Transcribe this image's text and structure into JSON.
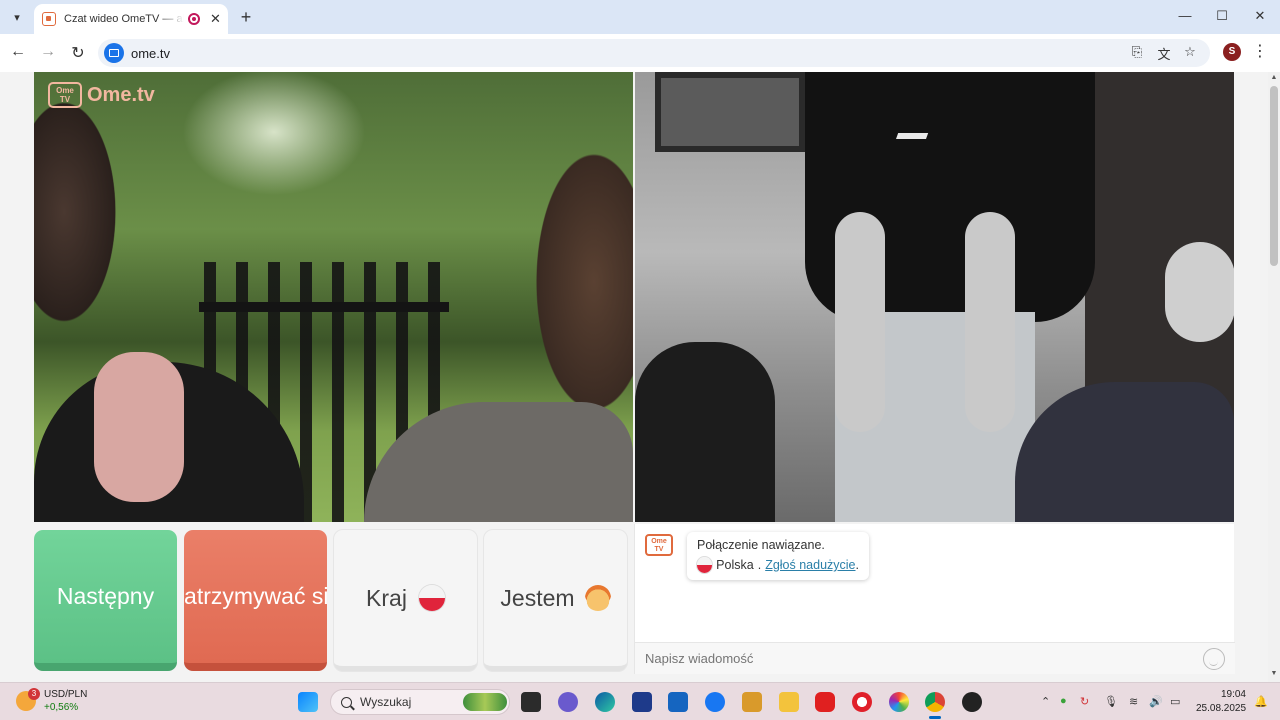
{
  "browser": {
    "tab": {
      "title": "Czat wideo OmeTV — alternatywa",
      "close": "✕"
    },
    "new_tab": "+",
    "window": {
      "minimize": "—",
      "maximize": "☐",
      "close": "✕"
    },
    "nav": {
      "back": "←",
      "forward": "→",
      "reload": "↻"
    },
    "url": "ome.tv",
    "profile_initial": "S",
    "menu": "⋮"
  },
  "page": {
    "logo": {
      "badge_line1": "Ome",
      "badge_line2": "TV",
      "text": "Ome.tv"
    },
    "buttons": {
      "next": "Następny",
      "stop": "Zatrzymywać się",
      "country": "Kraj",
      "me": "Jestem"
    },
    "chat": {
      "badge_line1": "Ome",
      "badge_line2": "TV",
      "connected": "Połączenie nawiązane.",
      "country": "Polska",
      "separator": ".",
      "report": "Zgłoś nadużycie",
      "report_end": ".",
      "input_placeholder": "Napisz wiadomość"
    }
  },
  "taskbar": {
    "weather_badge": "3",
    "ticker": "USD/PLN",
    "change": "+0,56%",
    "search_label": "Wyszukaj",
    "time": "19:04",
    "date": "25.08.2025"
  },
  "colors": {
    "next_button": "#5cc186",
    "stop_button": "#e06a52",
    "brand": "#e06a3d",
    "link": "#2a7fa8"
  }
}
